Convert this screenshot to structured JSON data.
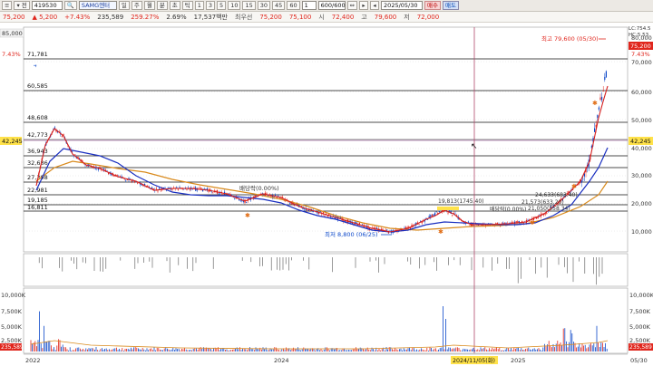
{
  "toolbar": {
    "menu_icon": "≡",
    "type": "▾ 전",
    "code": "419530",
    "search_icon": "🔍",
    "name": "SAMG엔터",
    "tools": [
      "일",
      "주",
      "월",
      "분",
      "초",
      "틱"
    ],
    "minutes": [
      "1",
      "3",
      "5",
      "10",
      "15",
      "30",
      "45",
      "60"
    ],
    "step": "1",
    "count": "600/600",
    "nav_icons": [
      "⇔",
      "▸",
      "◂"
    ],
    "date": "2025/05/30",
    "buy": "매수",
    "sell": "매도"
  },
  "quote": {
    "price": "75,200",
    "change": "▲ 5,200",
    "change_pct": "+7.43%",
    "volume": "235,589",
    "volume_ratio": "259.27%",
    "turnover": "2.69%",
    "amount": "17,537백만",
    "ask_label": "최우선",
    "ask": "75,200",
    "bid": "75,100",
    "open_label": "시",
    "open": "72,400",
    "high_label": "고",
    "high": "79,600",
    "low_label": "저",
    "low": "72,000"
  },
  "chart": {
    "type": "candlestick",
    "right_axis": [
      "80,000",
      "70,000",
      "60,000",
      "50,000",
      "40,000",
      "30,000",
      "20,000",
      "10,000"
    ],
    "left_axis_top": "85,000",
    "level_lines": [
      "71,781",
      "60,585",
      "48,608",
      "42,773",
      "36,943",
      "32,686",
      "27,398",
      "22,981",
      "19,185",
      "16,811"
    ],
    "price_tag_left": "42,245",
    "price_tag_right": "42,245",
    "current_tag": "75,200",
    "current_pct_left": "7.43%",
    "current_pct_right": "7.43%",
    "lc_label": "LC:754.5",
    "hc_label": "HC:5.53",
    "annotations": {
      "high": "최고 79,600 (05/30)",
      "low": "최저 8,800 (06/25)",
      "dividend1": "배당락(0.00%)",
      "mid_high": "19,813(1745.40)",
      "dividend2": "배당락(0.00%)",
      "cluster1": "24,633(683.40)",
      "cluster2": "21,573(633.20)",
      "cluster3": "21,050(558.34)"
    },
    "volume_axis": [
      "10,000K",
      "7,500K",
      "5,000K",
      "2,500K"
    ],
    "volume_tag": "235,589",
    "x_labels": [
      "2022",
      "2024",
      "2024/11/05(화)",
      "2025",
      "05/30"
    ]
  },
  "colors": {
    "up": "#e0261d",
    "down": "#0b47c9",
    "ma_short": "#d41f1f",
    "ma_mid": "#1a2fc0",
    "ma_long": "#d98a1c",
    "crosshair": "#b04a6a"
  }
}
